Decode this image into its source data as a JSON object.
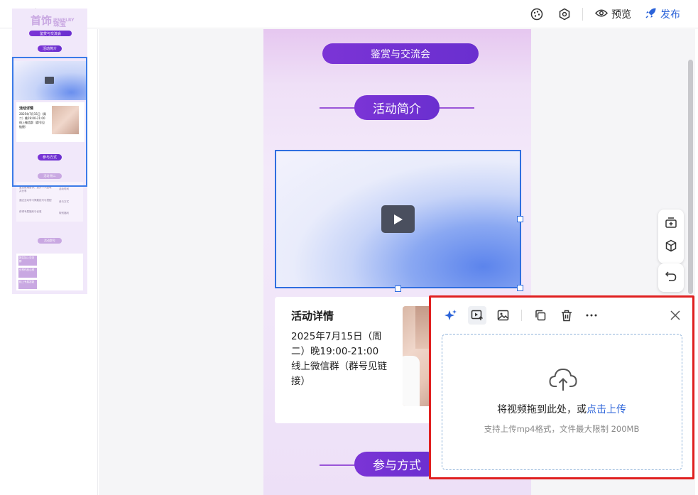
{
  "topbar": {
    "preview_label": "预览",
    "publish_label": "发布",
    "accent": "#2b63d9"
  },
  "thumbnail": {
    "brand_title": "首饰",
    "brand_sub": "珠宝",
    "brand_en": "JEWELRY",
    "banner": "鉴赏与交流会",
    "intro": "活动简介",
    "detail_title": "活动详情",
    "detail_text": "2025年7月15日（周二）晚19:00-21:00线上微信群（群号见链接）",
    "join": "参与方式",
    "sec2": "活动 附二",
    "sec3": "活动群号",
    "list_a": [
      "鉴赏新潮首饰，提升个人品味并分享",
      "通过互动学习佩戴技巧与搭配",
      "获得专属福利与优惠"
    ],
    "list_b": [
      "活动时间",
      "参与方式",
      "特别福利"
    ],
    "rows": [
      "报名加入交流群",
      "分享作品心得",
      "线上专属答疑"
    ]
  },
  "page": {
    "banner": "鉴赏与交流会",
    "intro_title": "活动简介",
    "detail_title": "活动详情",
    "detail_lines": [
      "2025年7月15日（周",
      "二）晚19:00-21:00",
      "线上微信群（群号见链",
      "接）"
    ],
    "join_title": "参与方式"
  },
  "popup": {
    "drop_text": "将视频拖到此处，或",
    "drop_link": "点击上传",
    "hint": "支持上传mp4格式，文件最大限制 200MB"
  }
}
